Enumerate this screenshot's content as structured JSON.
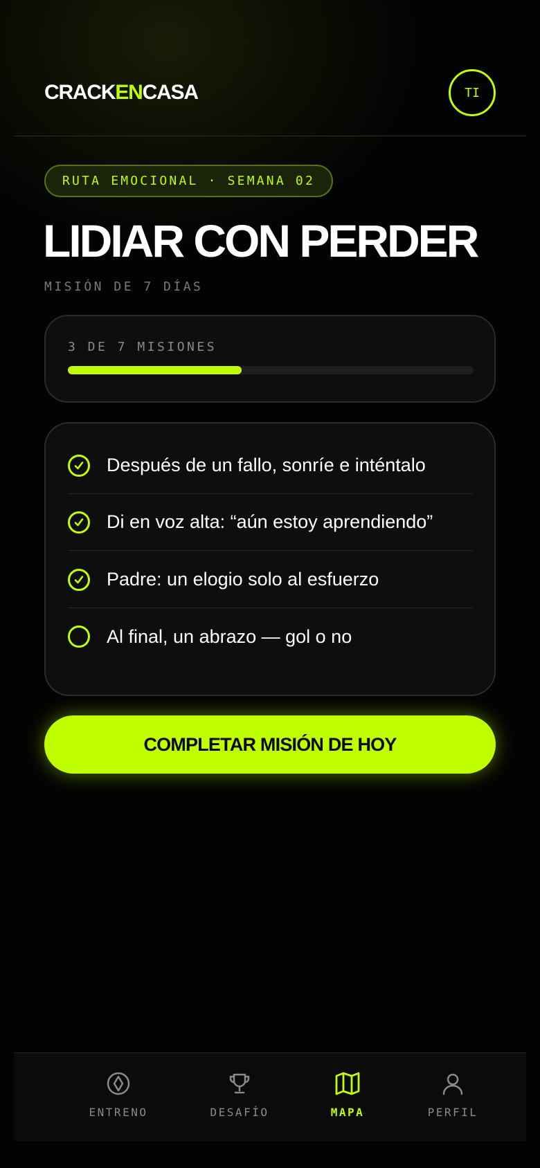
{
  "brand": {
    "logo_part1": "CRACK",
    "logo_part2": "EN",
    "logo_part3": "CASA",
    "accent_color": "#bfff00"
  },
  "header": {
    "avatar_initials": "TI"
  },
  "mission_page": {
    "route_pill": "RUTA EMOCIONAL · SEMANA 02",
    "title": "LIDIAR CON PERDER",
    "subtitle": "MISIÓN DE 7 DÍAS"
  },
  "progress": {
    "label": "3 DE 7 MISIONES",
    "completed": 3,
    "total": 7
  },
  "missions": [
    {
      "text": "Después de un fallo, sonríe e inténtalo",
      "done": true
    },
    {
      "text": "Di en voz alta: “aún estoy aprendiendo”",
      "done": true
    },
    {
      "text": "Padre: un elogio solo al esfuerzo",
      "done": true
    },
    {
      "text": "Al final, un abrazo — gol o no",
      "done": false
    }
  ],
  "cta": {
    "label": "COMPLETAR MISIÓN DE HOY"
  },
  "bottom_nav": {
    "items": [
      {
        "label": "ENTRENO",
        "icon": "ball-icon",
        "active": false
      },
      {
        "label": "DESAFÍO",
        "icon": "trophy-icon",
        "active": false
      },
      {
        "label": "MAPA",
        "icon": "map-icon",
        "active": true
      },
      {
        "label": "PERFIL",
        "icon": "user-icon",
        "active": false
      }
    ]
  }
}
